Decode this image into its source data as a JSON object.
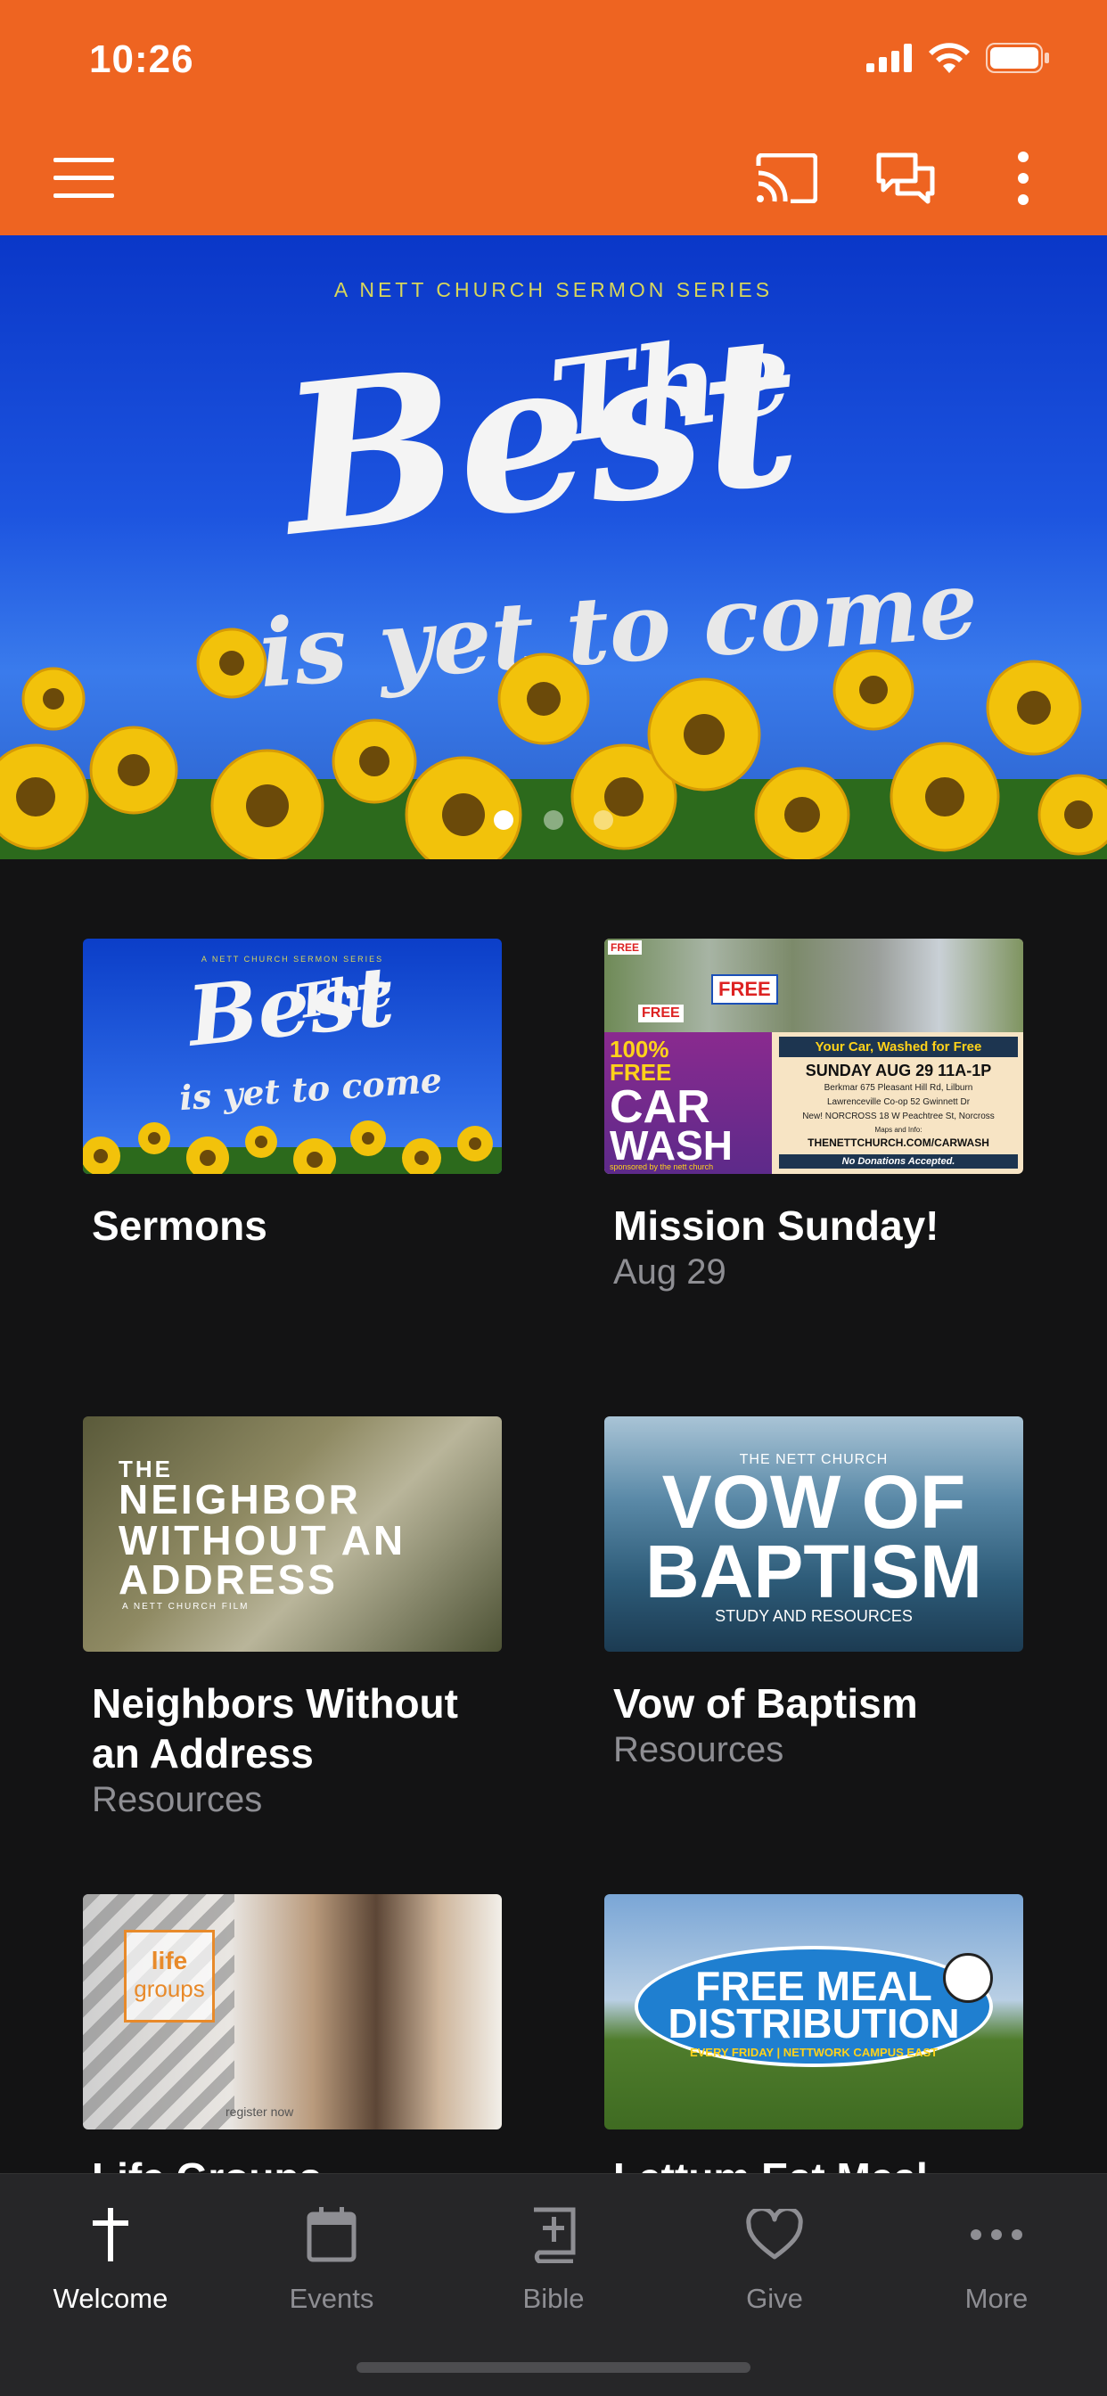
{
  "status_bar": {
    "time": "10:26"
  },
  "hero": {
    "kicker": "A NETT CHURCH SERMON SERIES",
    "title_line1": "The",
    "title_line2": "Best",
    "title_line3": "is yet to come",
    "slides": 3,
    "active_slide": 1
  },
  "tiles": [
    {
      "title": "Sermons",
      "subtitle": "",
      "thumb": {
        "kicker": "A NETT CHURCH SERMON SERIES",
        "the": "The",
        "best": "Best",
        "sub": "is yet to come"
      }
    },
    {
      "title": "Mission Sunday!",
      "subtitle": "Aug 29",
      "thumb": {
        "free1": "FREE",
        "free2": "FREE",
        "pct": "100%",
        "free3": "FREE",
        "car": "CAR",
        "wash": "WASH",
        "sponsor": "sponsored by the nett church",
        "header": "Your Car, Washed for Free",
        "date": "SUNDAY AUG 29 11A-1P",
        "loc1": "Berkmar 675 Pleasant Hill Rd, Lilburn",
        "loc2": "Lawrenceville Co-op 52 Gwinnett Dr",
        "loc3": "New! NORCROSS 18 W Peachtree St, Norcross",
        "maps": "Maps and Info:",
        "url": "THENETTCHURCH.COM/CARWASH",
        "note": "No Donations Accepted."
      }
    },
    {
      "title": "Neighbors Without an Address",
      "subtitle": "Resources",
      "thumb": {
        "l1": "THE",
        "l2": "NEIGHBOR",
        "l3": "WITHOUT AN",
        "l4": "ADDRESS",
        "film": "A NETT CHURCH FILM"
      }
    },
    {
      "title": "Vow of Baptism",
      "subtitle": "Resources",
      "thumb": {
        "top": "THE NETT CHURCH",
        "l1": "VOW OF",
        "l2": "BAPTISM",
        "sub": "STUDY AND RESOURCES"
      }
    },
    {
      "title": "Life Groups",
      "subtitle": "",
      "thumb": {
        "l1": "life",
        "l2": "groups",
        "register": "register now"
      }
    },
    {
      "title": "Lettum Eat Meal",
      "subtitle": "",
      "thumb": {
        "l1": "FREE MEAL",
        "l2": "DISTRIBUTION",
        "sub": "EVERY FRIDAY | NETTWORK CAMPUS EAST"
      }
    }
  ],
  "tabbar": {
    "items": [
      {
        "label": "Welcome",
        "icon": "cross-icon",
        "active": true
      },
      {
        "label": "Events",
        "icon": "calendar-icon",
        "active": false
      },
      {
        "label": "Bible",
        "icon": "bible-icon",
        "active": false
      },
      {
        "label": "Give",
        "icon": "heart-icon",
        "active": false
      },
      {
        "label": "More",
        "icon": "more-icon",
        "active": false
      }
    ]
  },
  "colors": {
    "brand": "#ee6421",
    "background": "#131314",
    "tabbar": "#262628",
    "muted": "#8e8e93"
  }
}
